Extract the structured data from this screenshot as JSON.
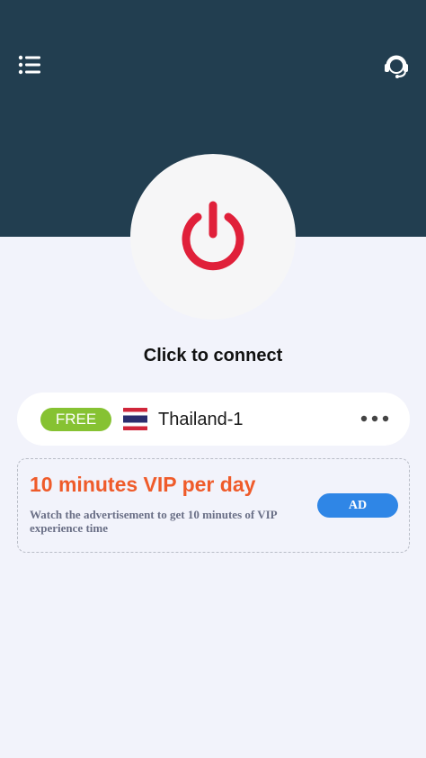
{
  "header": {
    "menu_icon": "menu-list-icon",
    "support_icon": "headset-support-icon",
    "background_color": "#223e50"
  },
  "power": {
    "icon": "power-icon",
    "accent_color": "#e0203a",
    "label": "Click to connect"
  },
  "server": {
    "badge": "FREE",
    "flag_icon": "thailand-flag-icon",
    "name": "Thailand-1",
    "more_icon": "more-dots-icon"
  },
  "vip_offer": {
    "title": "10 minutes VIP per day",
    "description": "Watch the advertisement to get 10 minutes of VIP experience time",
    "ad_button": "AD",
    "title_color": "#ef5b2a",
    "button_color": "#2f86e6"
  }
}
